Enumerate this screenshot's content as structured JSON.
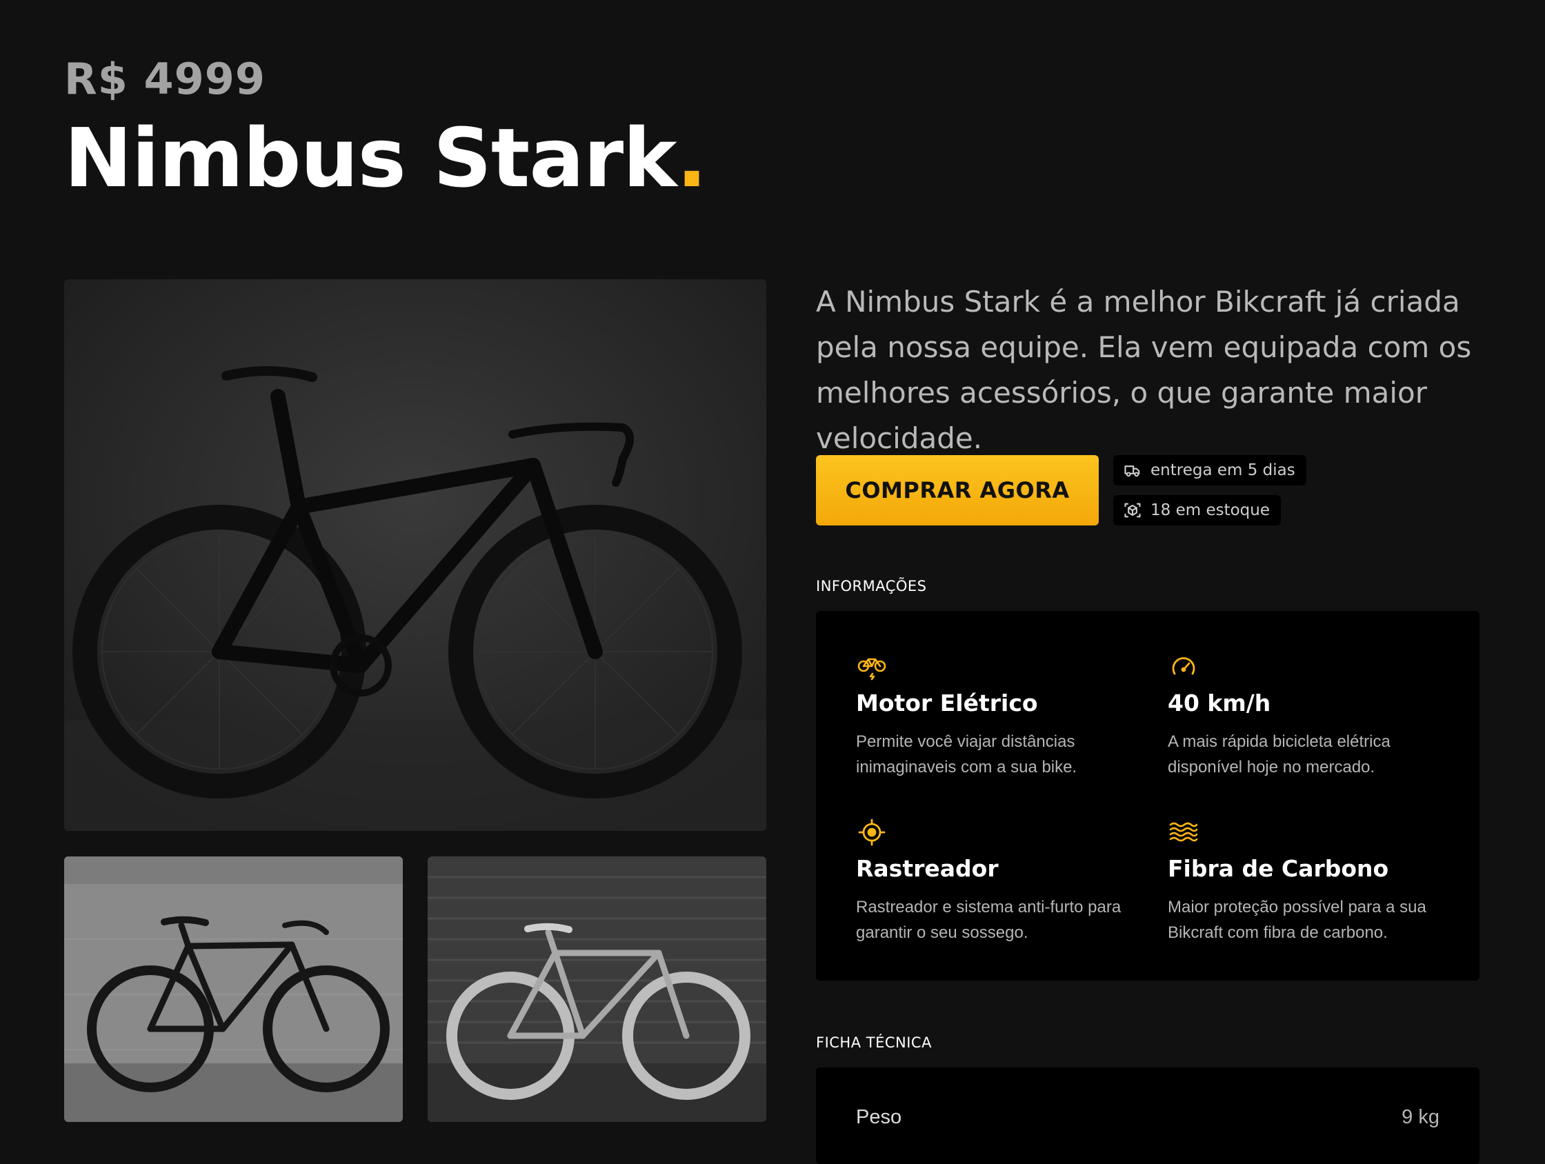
{
  "product": {
    "price": "R$ 4999",
    "name": "Nimbus Stark",
    "name_dot": ".",
    "description": "A Nimbus Stark é a melhor Bikcraft já criada pela nossa equipe. Ela vem equipada com os melhores acessórios, o que garante maior velocidade."
  },
  "actions": {
    "buy_label": "COMPRAR AGORA"
  },
  "badges": {
    "delivery": "entrega em 5 dias",
    "delivery_icon": "truck-icon",
    "stock": "18 em estoque",
    "stock_icon": "box-icon"
  },
  "info": {
    "title": "INFORMAÇÕES",
    "features": [
      {
        "icon": "bike-icon",
        "name": "Motor Elétrico",
        "text": "Permite você viajar distâncias inimaginaveis com a sua bike."
      },
      {
        "icon": "speedometer-icon",
        "name": "40 km/h",
        "text": "A mais rápida bicicleta elétrica disponível hoje no mercado."
      },
      {
        "icon": "crosshair-icon",
        "name": "Rastreador",
        "text": "Rastreador e sistema anti-furto para garantir o seu sossego."
      },
      {
        "icon": "waves-icon",
        "name": "Fibra de Carbono",
        "text": "Maior proteção possível para a sua Bikcraft com fibra de carbono."
      }
    ]
  },
  "tech": {
    "title": "FICHA TÉCNICA",
    "rows": [
      {
        "label": "Peso",
        "value": "9 kg"
      }
    ]
  },
  "colors": {
    "background": "#111111",
    "panel": "#000000",
    "accent": "#fbb615",
    "muted_text": "#b5b5b5"
  }
}
